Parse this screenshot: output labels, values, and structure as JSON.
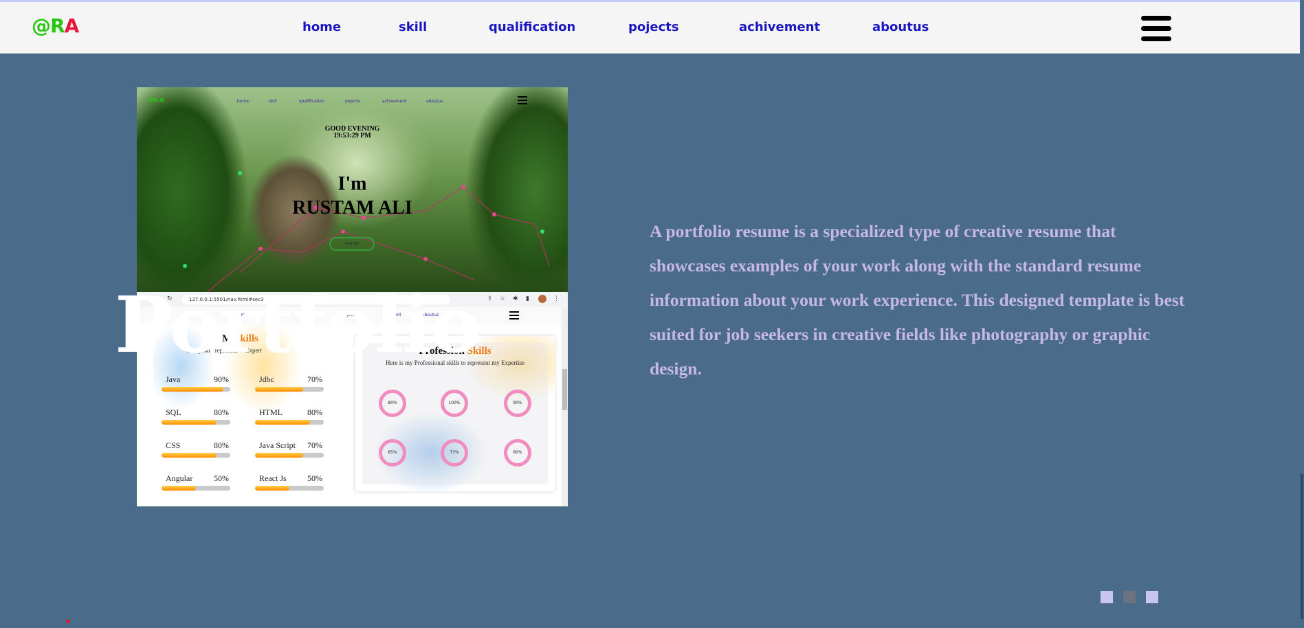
{
  "nav": {
    "logo": {
      "at": "@",
      "r": "R",
      "dot": ".",
      "a": "A"
    },
    "links": [
      "home",
      "skill",
      "qualification",
      "pojects",
      "achivement",
      "aboutus"
    ],
    "menu_icon": "hamburger-icon"
  },
  "screenshot": {
    "mini_logo": "@R.A",
    "mini_links": [
      "home",
      "skill",
      "qualification",
      "pojects",
      "achivement",
      "aboutus"
    ],
    "greeting": "GOOD EVENING",
    "time": "19:53:29 PM",
    "hero_line1": "I'm",
    "hero_line2": "RUSTAM ALI",
    "hire_button": "HIRE ME",
    "url": "127.0.0.1:5501/nav.html#sec3",
    "inner_links": [
      "home",
      "cation",
      "pojects",
      "ivement",
      "aboutus"
    ],
    "card1_title": "M",
    "card1_title_accent": "Skills",
    "card1_subtitle": "ere   y ski   represent     Expert",
    "skills_left": [
      {
        "name": "Java",
        "pct": "90%",
        "value": 0.9
      },
      {
        "name": "SQL",
        "pct": "80%",
        "value": 0.8
      },
      {
        "name": "CSS",
        "pct": "80%",
        "value": 0.8
      },
      {
        "name": "Angular",
        "pct": "50%",
        "value": 0.5
      }
    ],
    "skills_right": [
      {
        "name": "Jdbc",
        "pct": "70%",
        "value": 0.7
      },
      {
        "name": "HTML",
        "pct": "80%",
        "value": 0.8
      },
      {
        "name": "Java Script",
        "pct": "70%",
        "value": 0.7
      },
      {
        "name": "React Js",
        "pct": "50%",
        "value": 0.5
      }
    ],
    "card2_title": "Profession",
    "card2_title_accent": "Skills",
    "card2_subtitle": "Here is my Professional skills to represent my Expertise",
    "donuts": [
      "80%",
      "100%",
      "90%",
      "85%",
      "73%",
      "80%"
    ]
  },
  "hero": {
    "heading": "Portfolio",
    "description": "A portfolio resume is a specialized type of creative resume that showcases examples of your work along with the standard resume information about your work experience. This designed template is best suited for job seekers in creative fields like photography or graphic design."
  },
  "slider": {
    "dot_colors": [
      "#c8c6ef",
      "#6b7280",
      "#c8c6ef"
    ]
  },
  "colors": {
    "background": "#4a6b8a",
    "nav_link": "#1b16c4",
    "description": "#c5b9e3"
  }
}
